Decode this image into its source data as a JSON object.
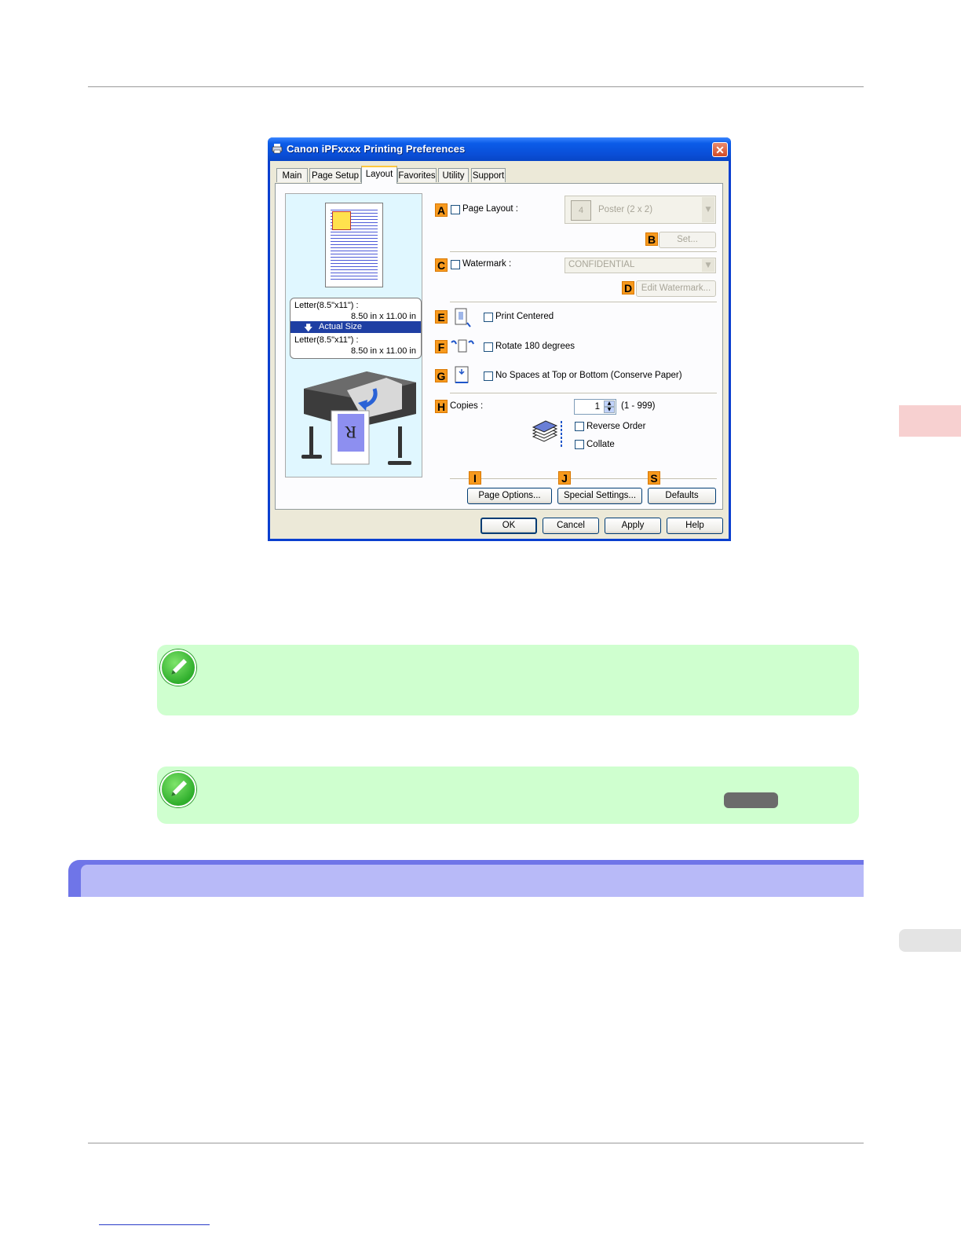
{
  "dialog": {
    "title": "Canon iPFxxxx Printing Preferences",
    "close_symbol": "✕",
    "tabs": [
      {
        "label": "Main"
      },
      {
        "label": "Page Setup"
      },
      {
        "label": "Layout"
      },
      {
        "label": "Favorites"
      },
      {
        "label": "Utility"
      },
      {
        "label": "Support"
      }
    ],
    "active_tab": "Layout",
    "preview": {
      "orig_size_label": "Letter(8.5\"x11\") :",
      "orig_size_value": "8.50 in x 11.00 in",
      "scale_label": "Actual Size",
      "out_size_label": "Letter(8.5\"x11\") :",
      "out_size_value": "8.50 in x 11.00 in"
    },
    "badges": {
      "A": "A",
      "B": "B",
      "C": "C",
      "D": "D",
      "E": "E",
      "F": "F",
      "G": "G",
      "H": "H",
      "I": "I",
      "J": "J",
      "S": "S"
    },
    "page_layout": {
      "label": "Page Layout :",
      "value": "Poster (2 x 2)",
      "icon_text": "4",
      "set_button": "Set..."
    },
    "watermark": {
      "label": "Watermark :",
      "value": "CONFIDENTIAL",
      "edit_button": "Edit Watermark..."
    },
    "print_centered": {
      "label": "Print Centered"
    },
    "rotate": {
      "label": "Rotate 180 degrees"
    },
    "no_spaces": {
      "label": "No Spaces at Top or Bottom (Conserve Paper)"
    },
    "copies": {
      "label": "Copies :",
      "value": "1",
      "range": "(1 - 999)"
    },
    "reverse_order": {
      "label": "Reverse Order"
    },
    "collate": {
      "label": "Collate"
    },
    "buttons": {
      "page_options": "Page Options...",
      "special_settings": "Special Settings...",
      "defaults": "Defaults",
      "ok": "OK",
      "cancel": "Cancel",
      "apply": "Apply",
      "help": "Help"
    }
  },
  "colors": {
    "titlebar": "#0a4fd8",
    "badge": "#f79a1e",
    "note_bg": "#cfffcf",
    "section_bar": "#6f75e8",
    "section_fill": "#b8baf8",
    "side_tab": "#f7d0d0"
  },
  "icons": {
    "printer_title": "printer-icon",
    "note": "pencil-note-icon"
  }
}
